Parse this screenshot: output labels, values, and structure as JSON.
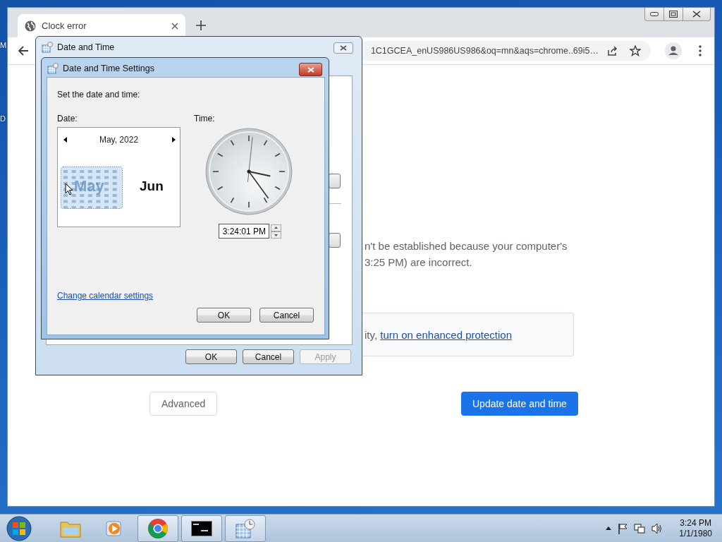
{
  "desktop": {
    "icon_labels": [
      "M",
      "D"
    ]
  },
  "browser": {
    "tab": {
      "title": "Clock error",
      "selected": true
    },
    "address": "1C1GCEA_enUS986US986&oq=mn&aqs=chrome..69i5…",
    "message_lines": [
      "n't be established because your computer's",
      "3:25 PM) are incorrect."
    ],
    "protection_note": {
      "text": "ity, ",
      "link": "turn on enhanced protection"
    },
    "buttons": [
      {
        "label": "Advanced",
        "kind": "secondary"
      },
      {
        "label": "Update date and time",
        "kind": "primary"
      }
    ]
  },
  "date_time_dialog": {
    "title": "Date and Time",
    "buttons": [
      {
        "label": "OK",
        "disabled": false
      },
      {
        "label": "Cancel",
        "disabled": false
      },
      {
        "label": "Apply",
        "disabled": true
      }
    ]
  },
  "settings_dialog": {
    "title": "Date and Time Settings",
    "prompt": "Set the date and time:",
    "date_label": "Date:",
    "time_label": "Time:",
    "calendar": {
      "header": "May, 2022",
      "outgoing_month": "May",
      "incoming_month": "Jun"
    },
    "time_value": "3:24:01 PM",
    "link": "Change calendar settings",
    "buttons": [
      "OK",
      "Cancel"
    ]
  },
  "taskbar": {
    "apps": [
      {
        "kind": "folder",
        "running": false
      },
      {
        "kind": "media",
        "running": false
      },
      {
        "kind": "chrome",
        "running": true
      },
      {
        "kind": "terminal",
        "running": true
      },
      {
        "kind": "calendar",
        "running": true
      }
    ],
    "clock": {
      "time": "3:24 PM",
      "date": "1/1/1980"
    }
  }
}
